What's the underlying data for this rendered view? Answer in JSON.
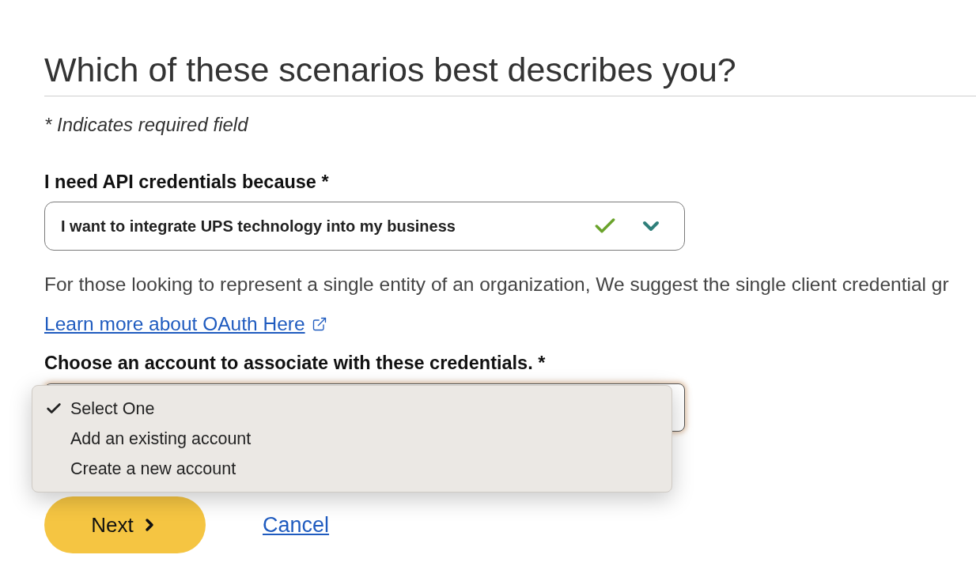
{
  "heading": "Which of these scenarios best describes you?",
  "required_note": "* Indicates required field",
  "reason_field": {
    "label": "I need API credentials because *",
    "value": "I want to integrate UPS technology into my business",
    "valid": true
  },
  "description": "For those looking to represent a single entity of an organization, We suggest the single client credential gr",
  "learn_more_link": "Learn more about OAuth Here",
  "account_field": {
    "label": "Choose an account to associate with these credentials. *",
    "focused": true,
    "expanded": true,
    "options": [
      {
        "label": "Select One",
        "selected": true
      },
      {
        "label": "Add an existing account",
        "selected": false
      },
      {
        "label": "Create a new account",
        "selected": false
      }
    ]
  },
  "buttons": {
    "next": "Next",
    "cancel": "Cancel"
  }
}
